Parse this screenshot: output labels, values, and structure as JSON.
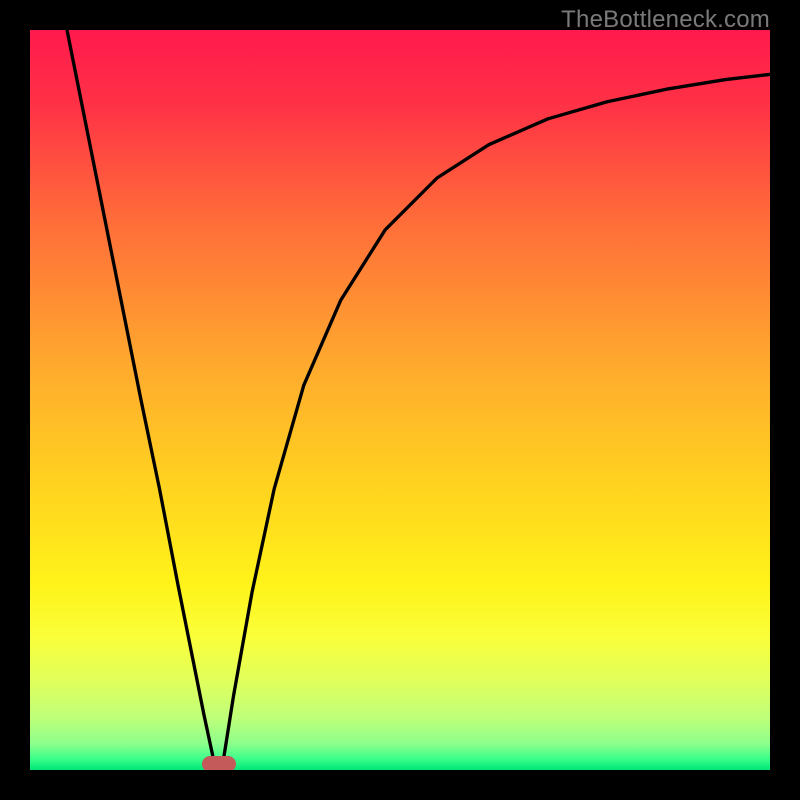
{
  "watermark": "TheBottleneck.com",
  "colors": {
    "frame": "#000000",
    "gradient_stops": [
      {
        "pct": 0,
        "color": "#ff1a4d"
      },
      {
        "pct": 10,
        "color": "#ff3146"
      },
      {
        "pct": 25,
        "color": "#ff6a3a"
      },
      {
        "pct": 45,
        "color": "#ffa92e"
      },
      {
        "pct": 62,
        "color": "#ffd41f"
      },
      {
        "pct": 75,
        "color": "#fff31a"
      },
      {
        "pct": 82,
        "color": "#faff3a"
      },
      {
        "pct": 88,
        "color": "#e0ff5c"
      },
      {
        "pct": 93,
        "color": "#beff7a"
      },
      {
        "pct": 96.5,
        "color": "#8cff8c"
      },
      {
        "pct": 98.5,
        "color": "#3aff8a"
      },
      {
        "pct": 100,
        "color": "#00e676"
      }
    ],
    "curve": "#000000",
    "marker": "#c45a5a"
  },
  "chart_data": {
    "type": "line",
    "title": "",
    "xlabel": "",
    "ylabel": "",
    "xlim": [
      0,
      100
    ],
    "ylim": [
      0,
      100
    ],
    "grid": false,
    "legend": false,
    "curve_points": [
      {
        "x": 5.0,
        "y": 100.0
      },
      {
        "x": 7.0,
        "y": 90.0
      },
      {
        "x": 10.0,
        "y": 75.0
      },
      {
        "x": 12.5,
        "y": 62.5
      },
      {
        "x": 15.0,
        "y": 50.0
      },
      {
        "x": 17.5,
        "y": 38.0
      },
      {
        "x": 20.0,
        "y": 25.0
      },
      {
        "x": 22.0,
        "y": 15.0
      },
      {
        "x": 23.5,
        "y": 7.5
      },
      {
        "x": 25.0,
        "y": 0.5
      },
      {
        "x": 25.5,
        "y": 0.0
      },
      {
        "x": 26.0,
        "y": 0.5
      },
      {
        "x": 27.5,
        "y": 10.0
      },
      {
        "x": 30.0,
        "y": 24.0
      },
      {
        "x": 33.0,
        "y": 38.0
      },
      {
        "x": 37.0,
        "y": 52.0
      },
      {
        "x": 42.0,
        "y": 63.5
      },
      {
        "x": 48.0,
        "y": 73.0
      },
      {
        "x": 55.0,
        "y": 80.0
      },
      {
        "x": 62.0,
        "y": 84.5
      },
      {
        "x": 70.0,
        "y": 88.0
      },
      {
        "x": 78.0,
        "y": 90.3
      },
      {
        "x": 86.0,
        "y": 92.0
      },
      {
        "x": 94.0,
        "y": 93.3
      },
      {
        "x": 100.0,
        "y": 94.0
      }
    ],
    "marker": {
      "x": 25.5,
      "y": 0.0
    }
  }
}
